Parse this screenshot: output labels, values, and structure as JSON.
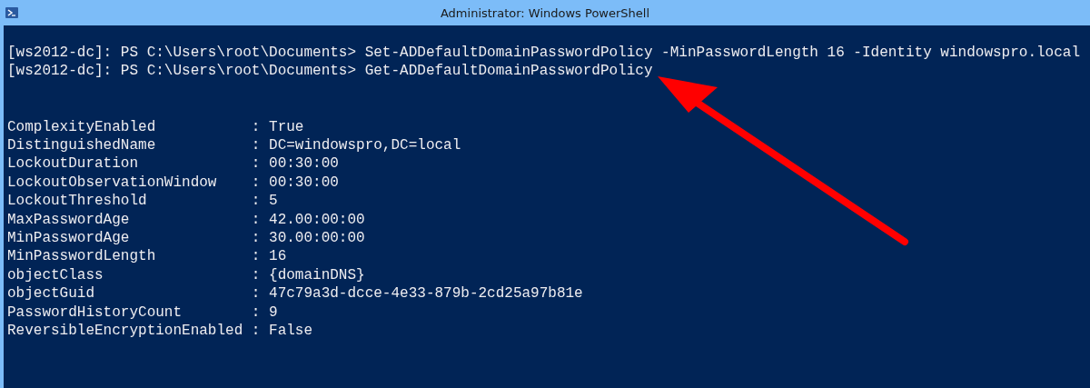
{
  "window": {
    "title": "Administrator: Windows PowerShell"
  },
  "console": {
    "commands": [
      {
        "prompt": "[ws2012-dc]: PS C:\\Users\\root\\Documents>",
        "command": "Set-ADDefaultDomainPasswordPolicy -MinPasswordLength 16 -Identity windowspro.local"
      },
      {
        "prompt": "[ws2012-dc]: PS C:\\Users\\root\\Documents>",
        "command": "Get-ADDefaultDomainPasswordPolicy"
      }
    ],
    "output_lines": [
      "ComplexityEnabled           : True",
      "DistinguishedName           : DC=windowspro,DC=local",
      "LockoutDuration             : 00:30:00",
      "LockoutObservationWindow    : 00:30:00",
      "LockoutThreshold            : 5",
      "MaxPasswordAge              : 42.00:00:00",
      "MinPasswordAge              : 30.00:00:00",
      "MinPasswordLength           : 16",
      "objectClass                 : {domainDNS}",
      "objectGuid                  : 47c79a3d-dcce-4e33-879b-2cd25a97b81e",
      "PasswordHistoryCount        : 9",
      "ReversibleEncryptionEnabled : False"
    ]
  }
}
